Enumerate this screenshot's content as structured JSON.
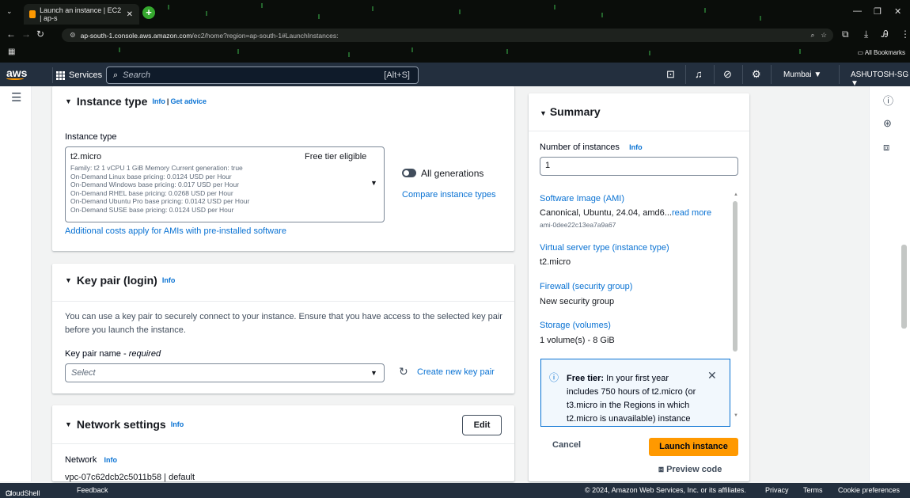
{
  "browser": {
    "tab_title": "Launch an instance | EC2 | ap-s",
    "url_host": "ap-south-1.console.aws.amazon.com",
    "url_path": "/ec2/home?region=ap-south-1#LaunchInstances:",
    "bookmarks_label": "All Bookmarks"
  },
  "awsnav": {
    "logo": "aws",
    "services_label": "Services",
    "search_placeholder": "Search",
    "search_shortcut": "[Alt+S]",
    "region": "Mumbai ▼",
    "account": "ASHUTOSH-SG ▼"
  },
  "instance_type": {
    "heading": "Instance type",
    "info": "Info",
    "sep": "|",
    "get_advice": "Get advice",
    "field_label": "Instance type",
    "selected": "t2.micro",
    "free_tier": "Free tier eligible",
    "details": [
      "Family: t2    1 vCPU    1 GiB Memory    Current generation: true",
      "On-Demand Linux base pricing: 0.0124 USD per Hour",
      "On-Demand Windows base pricing: 0.017 USD per Hour",
      "On-Demand RHEL base pricing: 0.0268 USD per Hour",
      "On-Demand Ubuntu Pro base pricing: 0.0142 USD per Hour",
      "On-Demand SUSE base pricing: 0.0124 USD per Hour"
    ],
    "all_generations": "All generations",
    "compare": "Compare instance types",
    "additional_costs": "Additional costs apply for AMIs with pre-installed software"
  },
  "key_pair": {
    "heading": "Key pair (login)",
    "info": "Info",
    "description_line1": "You can use a key pair to securely connect to your instance. Ensure that you have access to the selected key pair",
    "description_line2": "before you launch the instance.",
    "field_label": "Key pair name - ",
    "field_required": "required",
    "placeholder": "Select",
    "create_new": "Create new key pair"
  },
  "network": {
    "heading": "Network settings",
    "info": "Info",
    "edit": "Edit",
    "network_label": "Network",
    "network_info": "Info",
    "vpc": "vpc-07c62dcb2c5011b58 | default"
  },
  "summary": {
    "title": "Summary",
    "num_instances_label": "Number of instances",
    "num_info": "Info",
    "num_value": "1",
    "ami_label": "Software Image (AMI)",
    "ami_value": "Canonical, Ubuntu, 24.04, amd6...",
    "read_more": "read more",
    "ami_id": "ami-0dee22c13ea7a9a67",
    "server_type_label": "Virtual server type (instance type)",
    "server_type_value": "t2.micro",
    "firewall_label": "Firewall (security group)",
    "firewall_value": "New security group",
    "storage_label": "Storage (volumes)",
    "storage_value": "1 volume(s) - 8 GiB",
    "free_tier_bold": "Free tier:",
    "free_tier_line1": " In your first year",
    "free_tier_line2": "includes 750 hours of t2.micro (or",
    "free_tier_line3": "t3.micro in the Regions in which",
    "free_tier_line4": "t2.micro is unavailable) instance",
    "cancel": "Cancel",
    "launch": "Launch instance",
    "preview": "Preview code"
  },
  "footer": {
    "cloudshell": "CloudShell",
    "feedback": "Feedback",
    "copyright": "© 2024, Amazon Web Services, Inc. or its affiliates.",
    "privacy": "Privacy",
    "terms": "Terms",
    "cookie": "Cookie preferences"
  }
}
